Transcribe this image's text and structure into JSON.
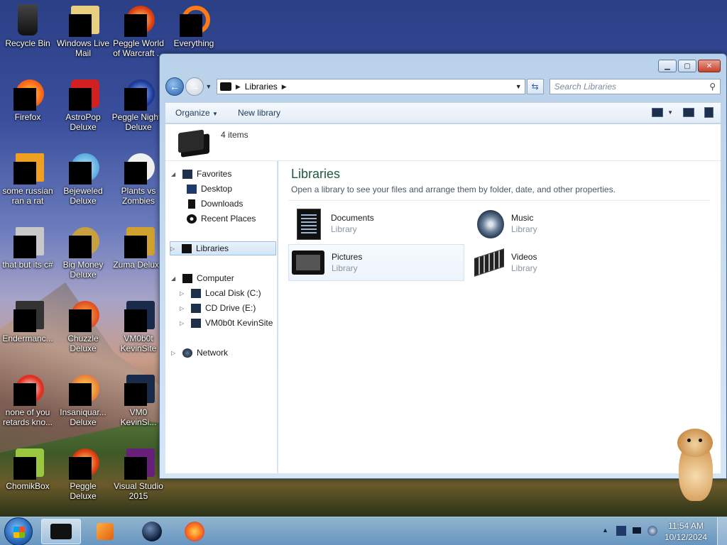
{
  "desktop": {
    "icons": [
      {
        "label": "Recycle Bin"
      },
      {
        "label": "Windows Live Mail"
      },
      {
        "label": "Peggle World of Warcraft ..."
      },
      {
        "label": "Everything"
      },
      {
        "label": "Firefox"
      },
      {
        "label": "AstroPop Deluxe"
      },
      {
        "label": "Peggle Nights Deluxe"
      },
      {
        "label": "some russian ran a rat"
      },
      {
        "label": "Bejeweled Deluxe"
      },
      {
        "label": "Plants vs Zombies"
      },
      {
        "label": "that but its c#"
      },
      {
        "label": "Big Money Deluxe"
      },
      {
        "label": "Zuma Deluxe"
      },
      {
        "label": "Endermanc..."
      },
      {
        "label": "Chuzzle Deluxe"
      },
      {
        "label": "VM0b0t KevinSite"
      },
      {
        "label": "none of you retards kno..."
      },
      {
        "label": "Insaniquar... Deluxe"
      },
      {
        "label": "VM0 KevinSi..."
      },
      {
        "label": "ChomikBox"
      },
      {
        "label": "Peggle Deluxe"
      },
      {
        "label": "Visual Studio 2015"
      }
    ]
  },
  "explorer": {
    "address": {
      "location": "Libraries"
    },
    "search": {
      "placeholder": "Search Libraries"
    },
    "toolbar": {
      "organize": "Organize",
      "new_library": "New library"
    },
    "info": {
      "count": "4 items"
    },
    "nav": {
      "favorites": "Favorites",
      "desktop": "Desktop",
      "downloads": "Downloads",
      "recent": "Recent Places",
      "libraries": "Libraries",
      "computer": "Computer",
      "local_disk": "Local Disk (C:)",
      "cd_drive": "CD Drive (E:)",
      "vm_site": "VM0b0t KevinSite",
      "network": "Network"
    },
    "content": {
      "title": "Libraries",
      "description": "Open a library to see your files and arrange them by folder, date, and other properties.",
      "libraries": [
        {
          "name": "Documents",
          "type": "Library"
        },
        {
          "name": "Music",
          "type": "Library"
        },
        {
          "name": "Pictures",
          "type": "Library"
        },
        {
          "name": "Videos",
          "type": "Library"
        }
      ]
    }
  },
  "taskbar": {
    "time": "11:54 AM",
    "date": "10/12/2024"
  },
  "colors": {
    "accent": "#2a5fa8",
    "library_title": "#1e5a3e"
  }
}
